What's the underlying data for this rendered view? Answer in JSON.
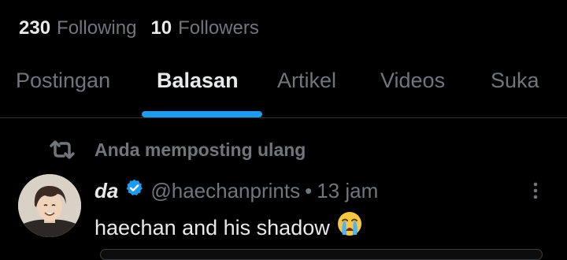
{
  "profile_stats": {
    "following_count": "230",
    "following_label": "Following",
    "followers_count": "10",
    "followers_label": "Followers"
  },
  "tabs": [
    {
      "label": "Postingan",
      "active": false
    },
    {
      "label": "Balasan",
      "active": true
    },
    {
      "label": "Artikel",
      "active": false
    },
    {
      "label": "Videos",
      "active": false
    },
    {
      "label": "Suka",
      "active": false
    }
  ],
  "repost": {
    "icon": "repost-icon",
    "label": "Anda memposting ulang"
  },
  "tweet": {
    "display_name": "da",
    "verified_icon": "verified-badge-icon",
    "handle": "@haechanprints",
    "separator": "•",
    "time": "13 jam",
    "text": "haechan and his shadow",
    "emoji": "loudly-crying-face-emoji",
    "menu_icon": "more-vertical-icon"
  },
  "colors": {
    "background": "#000000",
    "primary_text": "#e7e9ea",
    "secondary_text": "#71767b",
    "accent": "#1d9bf0",
    "divider": "#2f3336"
  }
}
